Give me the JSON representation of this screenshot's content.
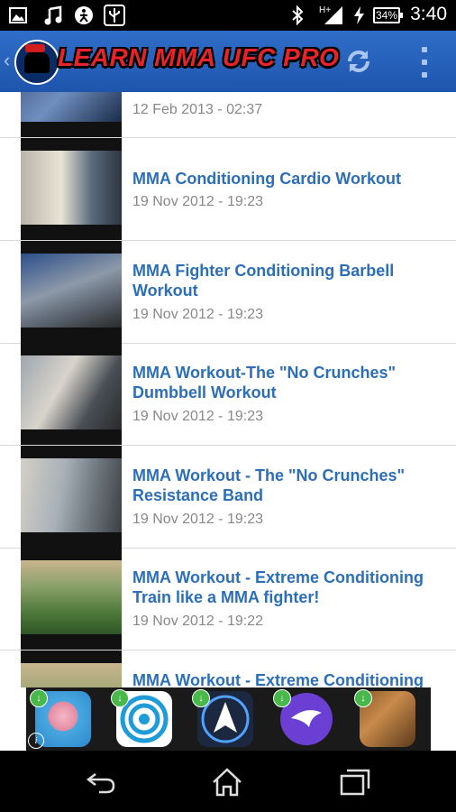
{
  "status_bar": {
    "time": "3:40",
    "battery": "34%",
    "icons": [
      "image-icon",
      "music-icon",
      "accessibility-icon",
      "usb-icon",
      "bluetooth-icon",
      "hplus-signal-icon",
      "charging-icon",
      "battery-icon"
    ]
  },
  "app_bar": {
    "title": "LEARN MMA UFC PRO",
    "back_icon": "chevron-left-icon",
    "logo_icon": "mma-logo-icon",
    "refresh_icon": "refresh-icon",
    "menu_icon": "overflow-menu-icon",
    "color": "#2f6ec9"
  },
  "videos": [
    {
      "title": "",
      "date": "12 Feb 2013 - 02:37"
    },
    {
      "title": "MMA Conditioning Cardio Workout",
      "date": "19 Nov 2012 - 19:23"
    },
    {
      "title": "MMA Fighter Conditioning Barbell Workout",
      "date": "19 Nov 2012 - 19:23"
    },
    {
      "title": "MMA Workout-The \"No Crunches\" Dumbbell Workout",
      "date": "19 Nov 2012 - 19:23"
    },
    {
      "title": "MMA Workout - The \"No Crunches\" Resistance Band",
      "date": "19 Nov 2012 - 19:23"
    },
    {
      "title": "MMA Workout - Extreme Conditioning Train like a MMA fighter!",
      "date": "19 Nov 2012 - 19:22"
    },
    {
      "title": "MMA Workout - Extreme Conditioning",
      "date": ""
    }
  ],
  "ad_banner": {
    "apps": [
      "cow-game-icon",
      "target-app-icon",
      "arrow-app-icon",
      "purple-bird-icon",
      "spartan-game-icon"
    ],
    "info_label": "i",
    "download_label": "↓"
  },
  "nav_bar": {
    "icons": [
      "back-icon",
      "home-icon",
      "recent-apps-icon"
    ]
  },
  "colors": {
    "title_link": "#2c6fb8",
    "date": "#888888",
    "app_title": "#e8242a"
  }
}
